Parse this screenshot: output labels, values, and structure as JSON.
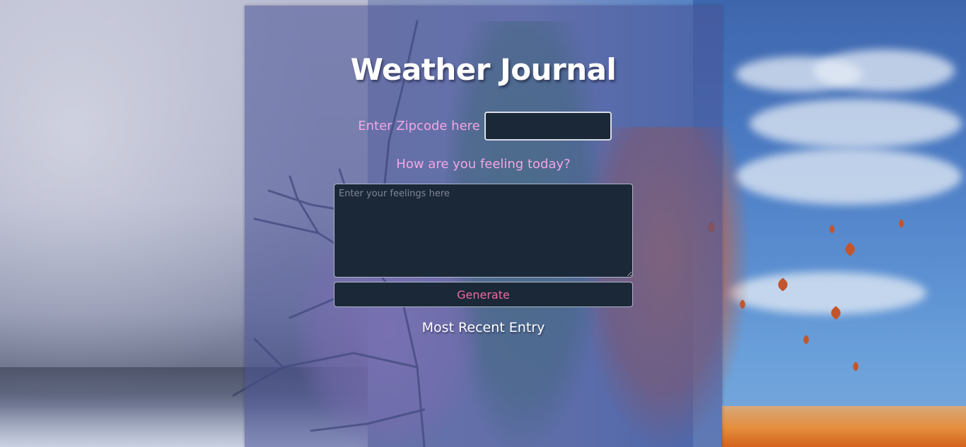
{
  "page": {
    "title": "Weather Journal"
  },
  "form": {
    "zip_label": "Enter Zipcode here",
    "zip_value": "",
    "feelings_label": "How are you feeling today?",
    "feelings_placeholder": "Enter your feelings here",
    "feelings_value": "",
    "generate_label": "Generate"
  },
  "entry": {
    "heading": "Most Recent Entry"
  },
  "colors": {
    "panel": "#4852969c",
    "label_pink": "#f3a6e4",
    "input_bg": "#1b2838",
    "button_text": "#ee6aa1",
    "title_text": "#ffffff"
  }
}
